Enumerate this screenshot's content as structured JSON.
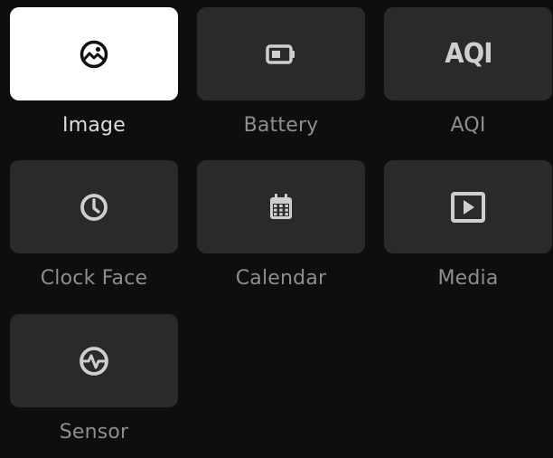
{
  "widgets": [
    {
      "label": "Image",
      "icon": "image-icon",
      "selected": true
    },
    {
      "label": "Battery",
      "icon": "battery-icon",
      "selected": false
    },
    {
      "label": "AQI",
      "icon": "aqi-icon",
      "icon_text": "AQI",
      "selected": false
    },
    {
      "label": "Clock Face",
      "icon": "clock-icon",
      "selected": false
    },
    {
      "label": "Calendar",
      "icon": "calendar-icon",
      "selected": false
    },
    {
      "label": "Media",
      "icon": "media-play-icon",
      "selected": false
    },
    {
      "label": "Sensor",
      "icon": "sensor-pulse-icon",
      "selected": false
    }
  ],
  "colors": {
    "background": "#0f0e0f",
    "tile": "#2a2a2a",
    "tile_selected": "#ffffff",
    "icon": "#cfcfcf",
    "label": "#8e8e8e"
  }
}
